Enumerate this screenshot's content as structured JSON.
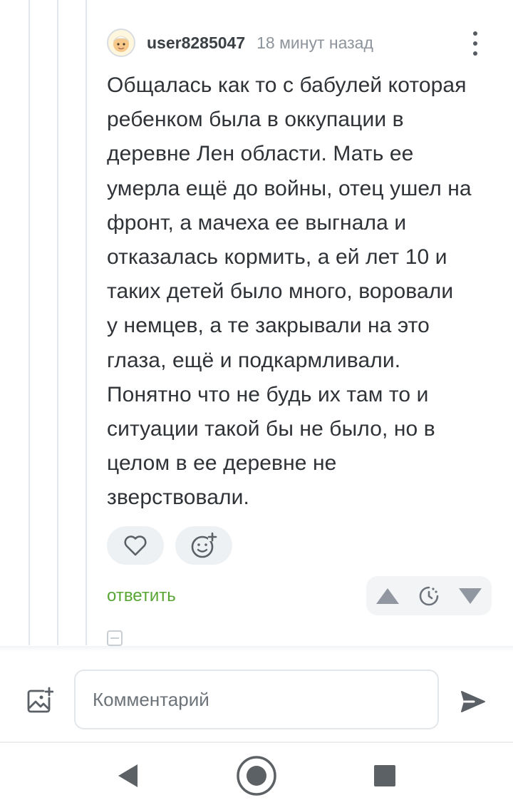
{
  "comment": {
    "username": "user8285047",
    "timestamp": "18 минут назад",
    "body": "Общалась как то с бабулей которая\nребенком была в оккупации в\nдеревне Лен области. Мать ее\nумерла ещё до войны, отец ушел на\nфронт, а мачеха ее выгнала и\nотказалась кормить, а ей лет 10 и\nтаких детей было много, воровали\nу немцев, а те закрывали на это\nглаза, ещё и подкармливали.\nПонятно что не будь их там то и\nситуации такой бы не было, но в\nцелом в ее деревне не\nзверствовали.",
    "reply_label": "ответить"
  },
  "icons": {
    "avatar": "avatar-face",
    "more": "more-vertical-icon",
    "like": "heart-icon",
    "reaction": "add-emoji-icon",
    "upvote": "triangle-up-icon",
    "timer": "clock-icon",
    "downvote": "triangle-down-icon",
    "collapse": "minus-square-icon",
    "attach": "image-add-icon",
    "send": "send-icon",
    "nav_back": "back-triangle-icon",
    "nav_home": "home-circle-icon",
    "nav_recents": "recents-square-icon"
  },
  "comment_form": {
    "placeholder": "Комментарий"
  },
  "colors": {
    "accent_green": "#5aa635",
    "text": "#2f3337",
    "muted": "#8d949b"
  }
}
